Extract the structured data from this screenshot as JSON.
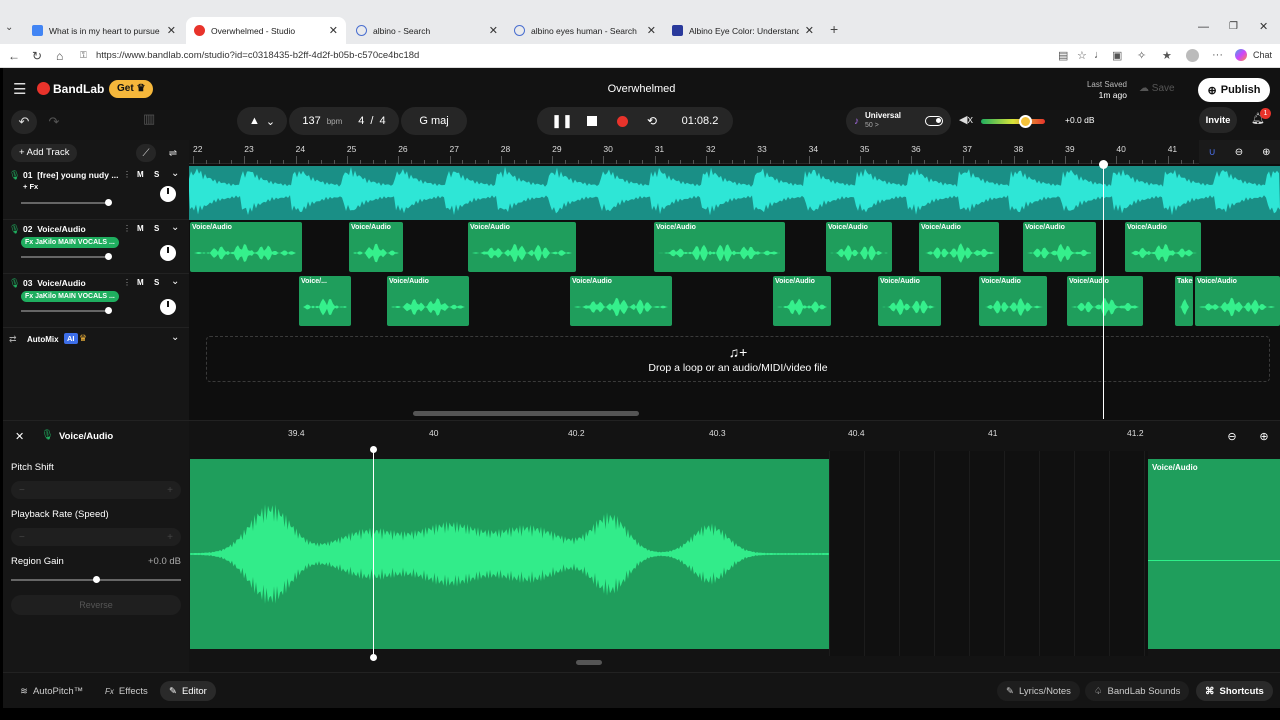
{
  "browser": {
    "tabs": [
      {
        "title": "What is in my heart to pursue - Go",
        "icon": "docs-icon",
        "color": "#4285f4"
      },
      {
        "title": "Overwhelmed - Studio",
        "icon": "bandlab-icon",
        "color": "#e8332b"
      },
      {
        "title": "albino - Search",
        "icon": "search-icon",
        "color": "#4a6fd0"
      },
      {
        "title": "albino eyes human - Search",
        "icon": "search-icon",
        "color": "#4a6fd0"
      },
      {
        "title": "Albino Eye Color: Understanding H",
        "icon": "site-icon",
        "color": "#2a3a9c"
      }
    ],
    "url": "https://www.bandlab.com/studio?id=c0318435-b2ff-4d2f-b05b-c570ce4bc18d",
    "chat_label": "Chat"
  },
  "app": {
    "brand": "BandLab",
    "get_label": "Get",
    "project_title": "Overwhelmed",
    "last_saved_label": "Last Saved",
    "last_saved_time": "1m ago",
    "save_label": "Save",
    "publish_label": "Publish",
    "invite_label": "Invite",
    "notification_count": "1",
    "accent": "#1fae5f"
  },
  "transport": {
    "bpm_value": "137",
    "bpm_unit": "bpm",
    "time_sig_num": "4",
    "time_sig_den": "4",
    "key": "G maj",
    "time": "01:08.2",
    "instrument_name": "Universal",
    "instrument_sub": "50 >",
    "volume_db": "+0.0 dB"
  },
  "tracks": [
    {
      "num": "01",
      "name": "[free] young nudy ...",
      "fx": "+ Fx",
      "has_fx_tag": false
    },
    {
      "num": "02",
      "name": "Voice/Audio",
      "fx": "Fx JaKilo MAIN VOCALS ...",
      "has_fx_tag": true
    },
    {
      "num": "03",
      "name": "Voice/Audio",
      "fx": "Fx JaKilo MAIN VOCALS ...",
      "has_fx_tag": true
    }
  ],
  "add_track_label": "Add Track",
  "automix_label": "AutoMix",
  "automix_ai": "AI",
  "ruler_bars": [
    "22",
    "23",
    "24",
    "25",
    "26",
    "27",
    "28",
    "29",
    "30",
    "31",
    "32",
    "33",
    "34",
    "35",
    "36",
    "37",
    "38",
    "39",
    "40",
    "41"
  ],
  "regions": {
    "track2": [
      "Voice/Audio",
      "Voice/Audio",
      "Voice/Audio",
      "Voice/Audio",
      "Voice/Audio",
      "Voice/Audio",
      "Voice/Audio",
      "Voice/Audio"
    ],
    "track3": [
      "Voice/...",
      "Voice/Audio",
      "Voice/Audio",
      "Voice/Audio",
      "Voice/Audio",
      "Voice/Audio",
      "Voice/Audio",
      "Takes",
      "Voice/Audio"
    ]
  },
  "dropzone_text": "Drop a loop or an audio/MIDI/video file",
  "editor": {
    "track_name": "Voice/Audio",
    "ruler": [
      "39.4",
      "40",
      "40.2",
      "40.3",
      "40.4",
      "41",
      "41.2"
    ],
    "pitch_shift_label": "Pitch Shift",
    "playback_rate_label": "Playback Rate (Speed)",
    "region_gain_label": "Region Gain",
    "region_gain_value": "+0.0 dB",
    "region_gain_level": 0.5,
    "reverse_label": "Reverse",
    "minus": "−",
    "plus": "+",
    "region2_label": "Voice/Audio"
  },
  "bottom": {
    "autopitch": "AutoPitch™",
    "effects": "Effects",
    "effects_prefix": "Fx",
    "editor": "Editor",
    "lyrics": "Lyrics/Notes",
    "sounds": "BandLab Sounds",
    "shortcuts": "Shortcuts"
  }
}
